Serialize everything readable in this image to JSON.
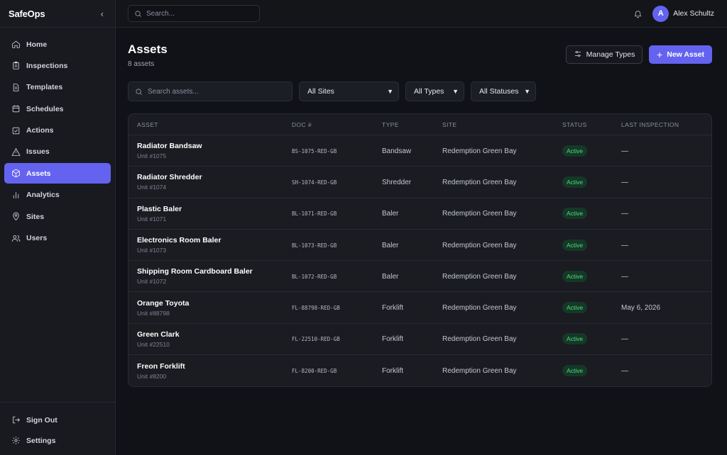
{
  "sidebar": {
    "brand": "SafeOps",
    "collapse_icon": "chevron-left-icon",
    "items": [
      {
        "label": "Home",
        "icon": "home-icon",
        "active": false
      },
      {
        "label": "Inspections",
        "icon": "clipboard-icon",
        "active": false
      },
      {
        "label": "Templates",
        "icon": "document-icon",
        "active": false
      },
      {
        "label": "Schedules",
        "icon": "calendar-icon",
        "active": false
      },
      {
        "label": "Actions",
        "icon": "check-square-icon",
        "active": false
      },
      {
        "label": "Issues",
        "icon": "warning-icon",
        "active": false
      },
      {
        "label": "Assets",
        "icon": "cube-icon",
        "active": true
      },
      {
        "label": "Analytics",
        "icon": "bar-chart-icon",
        "active": false
      },
      {
        "label": "Sites",
        "icon": "map-pin-icon",
        "active": false
      },
      {
        "label": "Users",
        "icon": "users-icon",
        "active": false
      }
    ],
    "bottom": [
      {
        "label": "Sign Out",
        "icon": "sign-out-icon"
      },
      {
        "label": "Settings",
        "icon": "gear-icon"
      }
    ]
  },
  "topbar": {
    "search_placeholder": "Search...",
    "user": {
      "initial": "A",
      "name": "Alex Schultz"
    }
  },
  "page": {
    "title": "Assets",
    "subtitle": "8 assets",
    "manage_types_label": "Manage Types",
    "new_asset_label": "New Asset",
    "search_placeholder": "Search assets...",
    "filters": {
      "sites": "All Sites",
      "types": "All Types",
      "statuses": "All Statuses"
    }
  },
  "table": {
    "columns": [
      "Asset",
      "Doc #",
      "Type",
      "Site",
      "Status",
      "Last Inspection"
    ],
    "rows": [
      {
        "name": "Radiator Bandsaw",
        "unit": "Unit #1075",
        "doc": "BS-1075-RED-GB",
        "type": "Bandsaw",
        "site": "Redemption Green Bay",
        "status": "Active",
        "last": "—"
      },
      {
        "name": "Radiator Shredder",
        "unit": "Unit #1074",
        "doc": "SH-1074-RED-GB",
        "type": "Shredder",
        "site": "Redemption Green Bay",
        "status": "Active",
        "last": "—"
      },
      {
        "name": "Plastic Baler",
        "unit": "Unit #1071",
        "doc": "BL-1071-RED-GB",
        "type": "Baler",
        "site": "Redemption Green Bay",
        "status": "Active",
        "last": "—"
      },
      {
        "name": "Electronics Room Baler",
        "unit": "Unit #1073",
        "doc": "BL-1073-RED-GB",
        "type": "Baler",
        "site": "Redemption Green Bay",
        "status": "Active",
        "last": "—"
      },
      {
        "name": "Shipping Room Cardboard Baler",
        "unit": "Unit #1072",
        "doc": "BL-1072-RED-GB",
        "type": "Baler",
        "site": "Redemption Green Bay",
        "status": "Active",
        "last": "—"
      },
      {
        "name": "Orange Toyota",
        "unit": "Unit #88798",
        "doc": "FL-88798-RED-GB",
        "type": "Forklift",
        "site": "Redemption Green Bay",
        "status": "Active",
        "last": "May 6, 2026"
      },
      {
        "name": "Green Clark",
        "unit": "Unit #22510",
        "doc": "FL-22510-RED-GB",
        "type": "Forklift",
        "site": "Redemption Green Bay",
        "status": "Active",
        "last": "—"
      },
      {
        "name": "Freon Forklift",
        "unit": "Unit #8200",
        "doc": "FL-8200-RED-GB",
        "type": "Forklift",
        "site": "Redemption Green Bay",
        "status": "Active",
        "last": "—"
      }
    ]
  },
  "colors": {
    "accent": "#6463f0",
    "background": "#111217",
    "sidebar": "#181a20",
    "status_active_bg": "#163826",
    "status_active_fg": "#4ade80"
  }
}
